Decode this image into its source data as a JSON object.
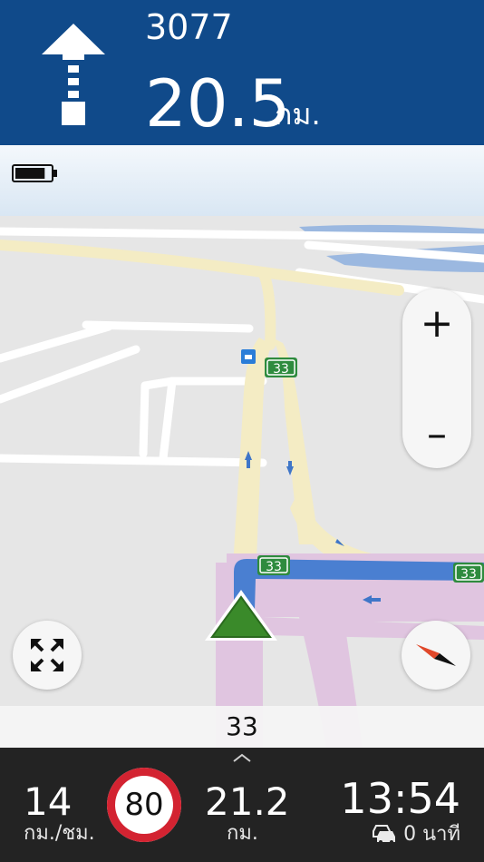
{
  "maneuver": {
    "road_number": "3077",
    "distance": "20.5",
    "distance_unit": "กม.",
    "icon": "straight-arrow-icon"
  },
  "status": {
    "battery_icon": "battery-icon",
    "battery_level": 0.85
  },
  "map": {
    "road_shields": [
      "33",
      "33",
      "33"
    ],
    "controls": {
      "zoom_in": "+",
      "zoom_out": "–",
      "fullscreen_icon": "expand-arrows-icon",
      "compass_icon": "compass-icon"
    },
    "poi_icon": "car-service-icon",
    "position_icon": "navigation-arrow-icon"
  },
  "current_street": "33",
  "footer": {
    "speed": "14",
    "speed_unit": "กม./ชม.",
    "speed_limit": "80",
    "remaining_distance": "21.2",
    "remaining_unit": "กม.",
    "eta": "13:54",
    "traffic_delay": "0 นาที",
    "traffic_icon": "traffic-cars-icon",
    "expand_icon": "chevron-up-icon"
  },
  "colors": {
    "header_bg": "#104a8a",
    "route": "#4a7fd1",
    "position_arrow": "#3a8a2a",
    "road_shield": "#2e8b3e",
    "speed_limit_ring": "#d32331",
    "footer_bg": "#232323"
  }
}
